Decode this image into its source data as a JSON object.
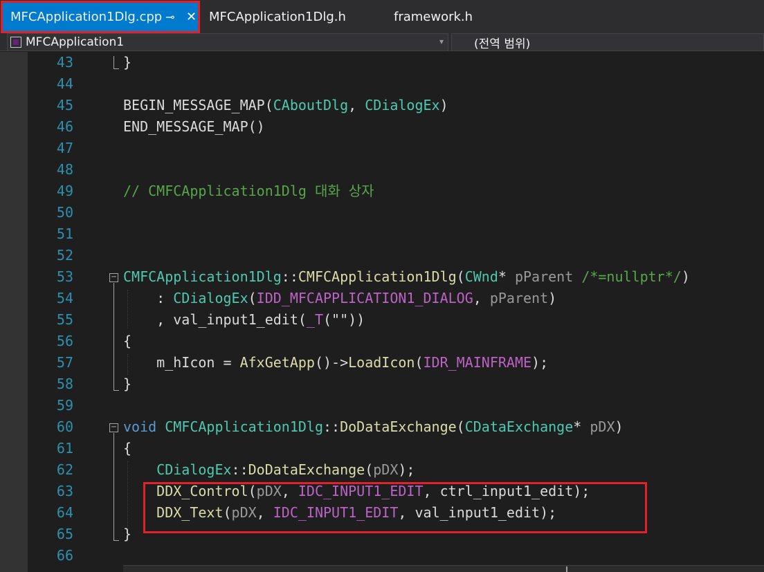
{
  "tabs": [
    {
      "label": "MFCApplication1Dlg.cpp",
      "pin_glyph": "⊸",
      "close_glyph": "✕",
      "active": true
    },
    {
      "label": "MFCApplication1Dlg.h"
    },
    {
      "label": "framework.h"
    }
  ],
  "navbar": {
    "project": "MFCApplication1",
    "scope": "(전역 범위)",
    "dropdown_glyph": "▾"
  },
  "editor": {
    "fold_glyph": "−",
    "lines": [
      {
        "n": "43",
        "tokens": [
          {
            "t": "}",
            "c": "default"
          }
        ]
      },
      {
        "n": "44",
        "tokens": []
      },
      {
        "n": "45",
        "tokens": [
          {
            "t": "BEGIN_MESSAGE_MAP",
            "c": "default"
          },
          {
            "t": "(",
            "c": "default"
          },
          {
            "t": "CAboutDlg",
            "c": "type"
          },
          {
            "t": ", ",
            "c": "default"
          },
          {
            "t": "CDialogEx",
            "c": "type"
          },
          {
            "t": ")",
            "c": "default"
          }
        ]
      },
      {
        "n": "46",
        "tokens": [
          {
            "t": "END_MESSAGE_MAP",
            "c": "default"
          },
          {
            "t": "()",
            "c": "default"
          }
        ]
      },
      {
        "n": "47",
        "tokens": []
      },
      {
        "n": "48",
        "tokens": []
      },
      {
        "n": "49",
        "tokens": [
          {
            "t": "// CMFCApplication1Dlg 대화 상자",
            "c": "comment"
          }
        ]
      },
      {
        "n": "50",
        "tokens": []
      },
      {
        "n": "51",
        "tokens": []
      },
      {
        "n": "52",
        "tokens": []
      },
      {
        "n": "53",
        "tokens": [
          {
            "t": "CMFCApplication1Dlg",
            "c": "type"
          },
          {
            "t": "::",
            "c": "default"
          },
          {
            "t": "CMFCApplication1Dlg",
            "c": "func"
          },
          {
            "t": "(",
            "c": "default"
          },
          {
            "t": "CWnd",
            "c": "type"
          },
          {
            "t": "* ",
            "c": "default"
          },
          {
            "t": "pParent",
            "c": "param"
          },
          {
            "t": " ",
            "c": "default"
          },
          {
            "t": "/*=nullptr*/",
            "c": "comment"
          },
          {
            "t": ")",
            "c": "default"
          }
        ]
      },
      {
        "n": "54",
        "tokens": [
          {
            "t": "    : ",
            "c": "default"
          },
          {
            "t": "CDialogEx",
            "c": "type"
          },
          {
            "t": "(",
            "c": "default"
          },
          {
            "t": "IDD_MFCAPPLICATION1_DIALOG",
            "c": "macro"
          },
          {
            "t": ", ",
            "c": "default"
          },
          {
            "t": "pParent",
            "c": "param"
          },
          {
            "t": ")",
            "c": "default"
          }
        ]
      },
      {
        "n": "55",
        "tokens": [
          {
            "t": "    , ",
            "c": "default"
          },
          {
            "t": "val_input1_edit",
            "c": "field"
          },
          {
            "t": "(",
            "c": "default"
          },
          {
            "t": "_T",
            "c": "macro"
          },
          {
            "t": "(\"\"))",
            "c": "default"
          }
        ]
      },
      {
        "n": "56",
        "tokens": [
          {
            "t": "{",
            "c": "default"
          }
        ]
      },
      {
        "n": "57",
        "tokens": [
          {
            "t": "    m_hIcon",
            "c": "field"
          },
          {
            "t": " = ",
            "c": "default"
          },
          {
            "t": "AfxGetApp",
            "c": "func"
          },
          {
            "t": "()->",
            "c": "default"
          },
          {
            "t": "LoadIcon",
            "c": "func"
          },
          {
            "t": "(",
            "c": "default"
          },
          {
            "t": "IDR_MAINFRAME",
            "c": "macro"
          },
          {
            "t": ");",
            "c": "default"
          }
        ]
      },
      {
        "n": "58",
        "tokens": [
          {
            "t": "}",
            "c": "default"
          }
        ]
      },
      {
        "n": "59",
        "tokens": []
      },
      {
        "n": "60",
        "tokens": [
          {
            "t": "void",
            "c": "kw"
          },
          {
            "t": " ",
            "c": "default"
          },
          {
            "t": "CMFCApplication1Dlg",
            "c": "type"
          },
          {
            "t": "::",
            "c": "default"
          },
          {
            "t": "DoDataExchange",
            "c": "func"
          },
          {
            "t": "(",
            "c": "default"
          },
          {
            "t": "CDataExchange",
            "c": "type"
          },
          {
            "t": "* ",
            "c": "default"
          },
          {
            "t": "pDX",
            "c": "param"
          },
          {
            "t": ")",
            "c": "default"
          }
        ]
      },
      {
        "n": "61",
        "tokens": [
          {
            "t": "{",
            "c": "default"
          }
        ]
      },
      {
        "n": "62",
        "tokens": [
          {
            "t": "    ",
            "c": "default"
          },
          {
            "t": "CDialogEx",
            "c": "type"
          },
          {
            "t": "::",
            "c": "default"
          },
          {
            "t": "DoDataExchange",
            "c": "func"
          },
          {
            "t": "(",
            "c": "default"
          },
          {
            "t": "pDX",
            "c": "param"
          },
          {
            "t": ");",
            "c": "default"
          }
        ]
      },
      {
        "n": "63",
        "tokens": [
          {
            "t": "    ",
            "c": "default"
          },
          {
            "t": "DDX_Control",
            "c": "func"
          },
          {
            "t": "(",
            "c": "default"
          },
          {
            "t": "pDX",
            "c": "param"
          },
          {
            "t": ", ",
            "c": "default"
          },
          {
            "t": "IDC_INPUT1_EDIT",
            "c": "macro"
          },
          {
            "t": ", ",
            "c": "default"
          },
          {
            "t": "ctrl_input1_edit",
            "c": "field"
          },
          {
            "t": ");",
            "c": "default"
          }
        ]
      },
      {
        "n": "64",
        "tokens": [
          {
            "t": "    ",
            "c": "default"
          },
          {
            "t": "DDX_Text",
            "c": "func"
          },
          {
            "t": "(",
            "c": "default"
          },
          {
            "t": "pDX",
            "c": "param"
          },
          {
            "t": ", ",
            "c": "default"
          },
          {
            "t": "IDC_INPUT1_EDIT",
            "c": "macro"
          },
          {
            "t": ", ",
            "c": "default"
          },
          {
            "t": "val_input1_edit",
            "c": "field"
          },
          {
            "t": ");",
            "c": "default"
          }
        ]
      },
      {
        "n": "65",
        "tokens": [
          {
            "t": "}",
            "c": "default"
          }
        ]
      },
      {
        "n": "66",
        "tokens": []
      }
    ]
  }
}
